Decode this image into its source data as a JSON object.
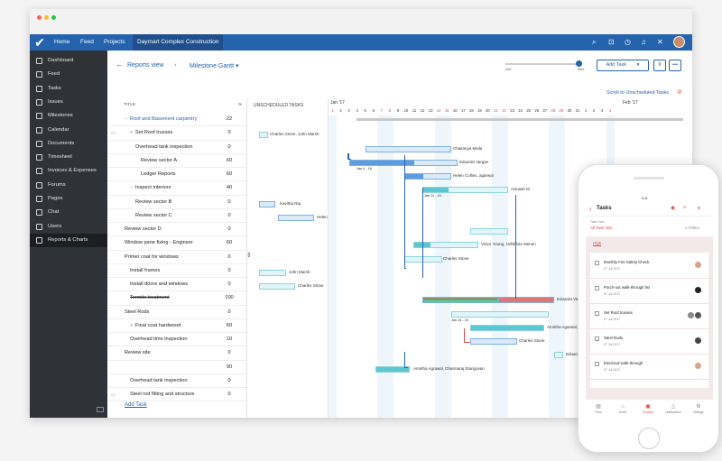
{
  "topnav": {
    "items": [
      "Home",
      "Feed",
      "Projects"
    ],
    "active": "Daymart Complex Construction"
  },
  "sidebar": {
    "items": [
      "Dashboard",
      "Feed",
      "Tasks",
      "Issues",
      "Milestones",
      "Calendar",
      "Documents",
      "Timesheet",
      "Invoices & Expenses",
      "Forums",
      "Pages",
      "Chat",
      "Users",
      "Reports & Charts"
    ],
    "active_index": 13
  },
  "header": {
    "back_glyph": "←",
    "reports_view": "Reports view",
    "separator": "›",
    "gantt_view": "Milestone Gantt",
    "add_task": "Add Task",
    "scroll_link": "Scroll to Unscheduled Tasks",
    "slider_min": "DAY",
    "slider_max": "MAX",
    "slider_level": 0.95
  },
  "table": {
    "col_title": "TITLE",
    "col_pct": "%",
    "rows": [
      {
        "name": "Roof and Basement carpentry",
        "pct": "22"
      },
      {
        "name": "Set Roof trusses",
        "pct": "0"
      },
      {
        "name": "Overhead tank inspection",
        "pct": "0"
      },
      {
        "name": "Review sector A",
        "pct": "60"
      },
      {
        "name": "Ledger Reports",
        "pct": "60"
      },
      {
        "name": "Inspect interiors",
        "pct": "40"
      },
      {
        "name": "Review sector B",
        "pct": "0"
      },
      {
        "name": "Review sector C",
        "pct": "0"
      },
      {
        "name": "Review sector D",
        "pct": "0"
      },
      {
        "name": "Window pane fixing - Engineer",
        "pct": "60"
      },
      {
        "name": "Primer coat for windows",
        "pct": "0"
      },
      {
        "name": "Install frames",
        "pct": "0"
      },
      {
        "name": "Install doors and windows",
        "pct": "0"
      },
      {
        "name": "Termite treatment",
        "pct": "100"
      },
      {
        "name": "Steel Rods",
        "pct": "0"
      },
      {
        "name": "Final coat hardwood",
        "pct": "60"
      },
      {
        "name": "Overhead time inspection",
        "pct": "10"
      },
      {
        "name": "Review site",
        "pct": "0"
      },
      {
        "name": "",
        "pct": "90"
      },
      {
        "name": "Overhead tank inspection",
        "pct": "0"
      },
      {
        "name": "Steel rod fitting and structure",
        "pct": "0"
      }
    ],
    "add_task": "Add Task"
  },
  "gantt": {
    "unscheduled_label": "UNSCHEDULED TASKS",
    "month1": "Jan '17",
    "month2": "Feb '17",
    "days": [
      "1",
      "2",
      "3",
      "4",
      "5",
      "6",
      "7",
      "8",
      "9",
      "10",
      "11",
      "12",
      "13",
      "14",
      "15",
      "16",
      "17",
      "18",
      "19",
      "20",
      "21",
      "22",
      "23",
      "24",
      "25",
      "26",
      "27",
      "28",
      "29",
      "30",
      "31",
      "1",
      "2",
      "3",
      "4"
    ],
    "labels": {
      "charles_marsh": "Charles Stone, John Marsh",
      "chaitanya": "Chaitanya Meila",
      "eduardo": "Eduardo Vargas",
      "jan4_16": "Jan 4 - 16",
      "helen_agarwal": "Helen Collins, agarwal",
      "avinash": "Avinash M",
      "jan11_19": "Jan 11 - 19",
      "kavitha": "Kavitha Raj",
      "helen": "Helen",
      "charles": "Charles Stone",
      "victor": "Victor Young, Udhbhav Menen",
      "charles2": "Charles Stone",
      "john_marsh": "John Marsh",
      "charles3": "Charles Stone",
      "eduardo_v": "Eduardo Vas",
      "jan14_24": "Jan 14 - 24",
      "amritha_charles": "Amritha Agarwal, Charles",
      "charles4": "Charles Stone",
      "edu": "Eduardo",
      "amritha_dharmaraj": "Amritha Agrawal, Dharmaraj Elangovan"
    }
  },
  "phone": {
    "status": "9:41",
    "title": "Tasks",
    "sub_label": "Task Lists",
    "sub_value": "All Task lists",
    "filters": "Filters",
    "group": "High",
    "items": [
      {
        "title": "Monthly Fire Safety Check",
        "date": "07 Jul 2017"
      },
      {
        "title": "Porch-out walk-through list",
        "date": "07 Jul 2017"
      },
      {
        "title": "Set Roof trusses",
        "date": "07 Jul 2017"
      },
      {
        "title": "Steel Rods",
        "date": "07 Jul 2017"
      },
      {
        "title": "Electrical walk-through",
        "date": "07 Jul 2017"
      }
    ],
    "nav": [
      "Feed",
      "Home",
      "Projects",
      "Notifications",
      "Settings"
    ]
  },
  "colors": {
    "brand": "#2563ad",
    "sidebar": "#2f3237",
    "accent_red": "#e04848",
    "bar_blue": "#5b9be0",
    "bar_teal": "#5cc6d1",
    "bar_green": "#5ec48a",
    "bar_red": "#e07575"
  }
}
